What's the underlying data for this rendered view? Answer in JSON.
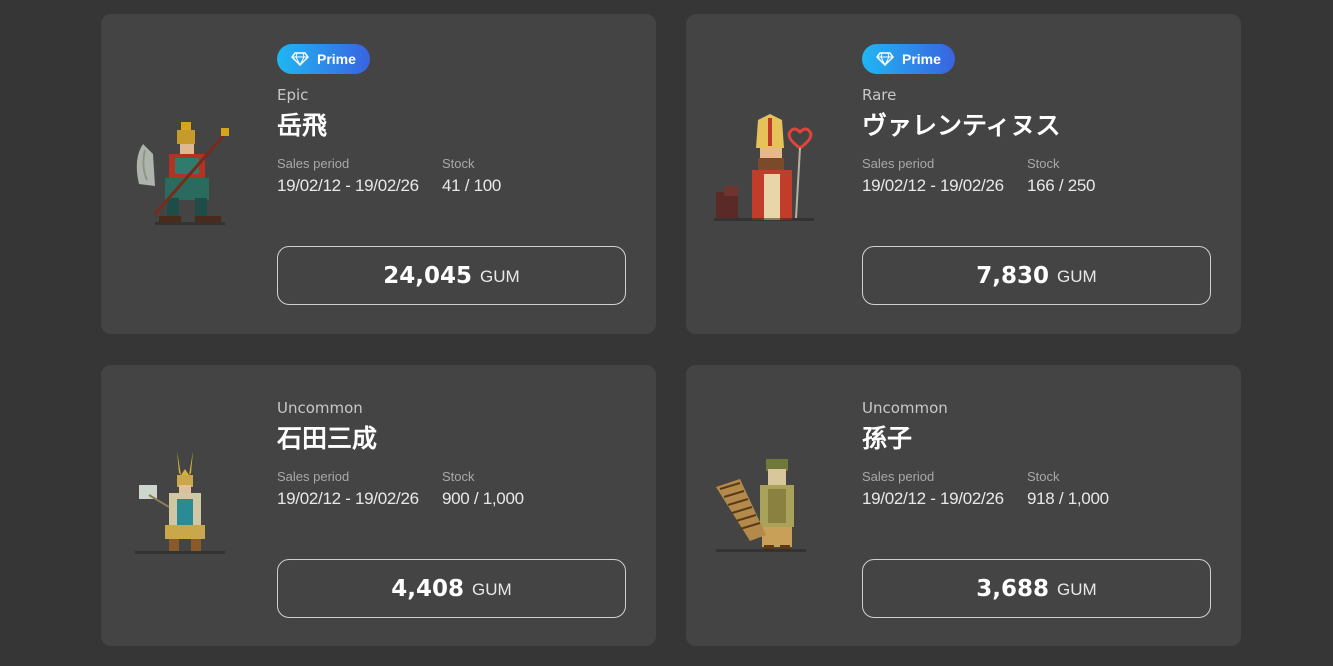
{
  "colors": {
    "background": "#363636",
    "card": "#444444",
    "prime_gradient_start": "#1fb6f3",
    "prime_gradient_end": "#3a63e0"
  },
  "cards": [
    {
      "prime": true,
      "badge_label": "Prime",
      "badge_icon": "diamond-icon",
      "rarity": "Epic",
      "name": "岳飛",
      "sales_period_label": "Sales period",
      "sales_period": "19/02/12 - 19/02/26",
      "stock_label": "Stock",
      "stock": "41 / 100",
      "price": "24,045",
      "currency": "GUM",
      "hero_icon": "warrior-hero-icon"
    },
    {
      "prime": true,
      "badge_label": "Prime",
      "badge_icon": "diamond-icon",
      "rarity": "Rare",
      "name": "ヴァレンティヌス",
      "sales_period_label": "Sales period",
      "sales_period": "19/02/12 - 19/02/26",
      "stock_label": "Stock",
      "stock": "166 / 250",
      "price": "7,830",
      "currency": "GUM",
      "hero_icon": "bishop-hero-icon"
    },
    {
      "prime": false,
      "rarity": "Uncommon",
      "name": "石田三成",
      "sales_period_label": "Sales period",
      "sales_period": "19/02/12 - 19/02/26",
      "stock_label": "Stock",
      "stock": "900 / 1,000",
      "price": "4,408",
      "currency": "GUM",
      "hero_icon": "samurai-hero-icon"
    },
    {
      "prime": false,
      "rarity": "Uncommon",
      "name": "孫子",
      "sales_period_label": "Sales period",
      "sales_period": "19/02/12 - 19/02/26",
      "stock_label": "Stock",
      "stock": "918 / 1,000",
      "price": "3,688",
      "currency": "GUM",
      "hero_icon": "strategist-hero-icon"
    }
  ]
}
